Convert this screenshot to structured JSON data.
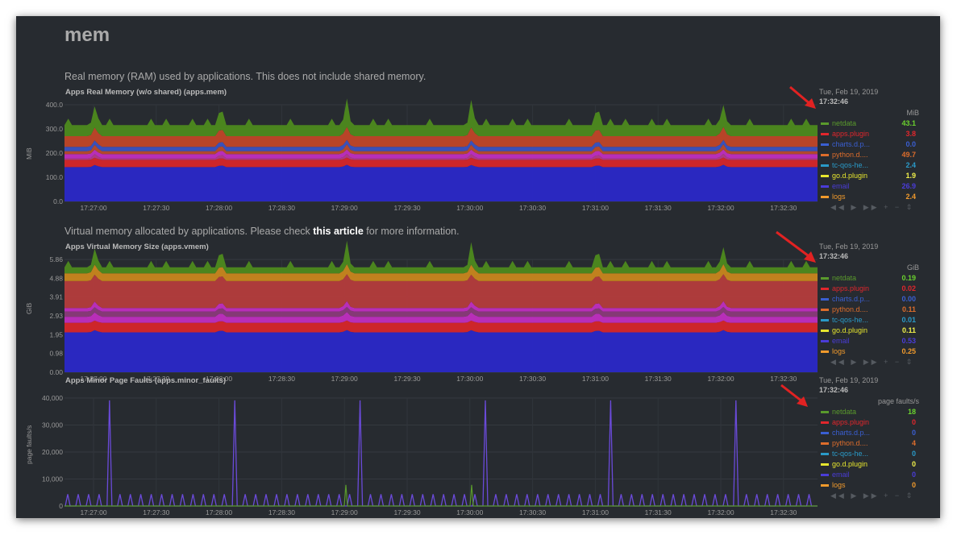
{
  "section": {
    "title": "mem"
  },
  "legend_series": [
    {
      "name": "netdata",
      "color": "#5a9a2c"
    },
    {
      "name": "apps.plugin",
      "color": "#e0262c"
    },
    {
      "name": "charts.d.p...",
      "color": "#3a5fd2"
    },
    {
      "name": "python.d....",
      "color": "#dd6d2b"
    },
    {
      "name": "tc-qos-he...",
      "color": "#2a9ac8"
    },
    {
      "name": "go.d.plugin",
      "color": "#e6e62e"
    },
    {
      "name": "email",
      "color": "#4a3cd8"
    },
    {
      "name": "logs",
      "color": "#f09a2c"
    }
  ],
  "controls": {
    "icons": [
      "rewind-icon",
      "play-icon",
      "forward-icon",
      "zoom-in-icon",
      "zoom-out-icon",
      "resize-icon"
    ],
    "glyphs": [
      "◀◀",
      "▶",
      "▶▶",
      "+",
      "−",
      "⇕"
    ]
  },
  "charts": [
    {
      "description": "Real memory (RAM) used by applications. This does not include shared memory.",
      "title": "Apps Real Memory (w/o shared) (apps.mem)",
      "y_unit_label": "MiB",
      "legend_units": "MiB",
      "date": "Tue, Feb 19, 2019",
      "time": "17:32:46",
      "values": [
        "43.1",
        "3.8",
        "0.0",
        "49.7",
        "2.4",
        "1.9",
        "26.9",
        "2.4"
      ],
      "value_colors": [
        "#6ad22e",
        "#e0262c",
        "#3a5fd2",
        "#dd6d2b",
        "#2a9ac8",
        "#f0f04a",
        "#4a3cd8",
        "#f09a2c"
      ]
    },
    {
      "description": "Virtual memory allocated by applications. Please check ",
      "link": "this article",
      "description_after": " for more information.",
      "title": "Apps Virtual Memory Size (apps.vmem)",
      "y_unit_label": "GiB",
      "legend_units": "GiB",
      "date": "Tue, Feb 19, 2019",
      "time": "17:32:46",
      "values": [
        "0.19",
        "0.02",
        "0.00",
        "0.11",
        "0.01",
        "0.11",
        "0.53",
        "0.25"
      ],
      "value_colors": [
        "#6ad22e",
        "#e0262c",
        "#3a5fd2",
        "#dd6d2b",
        "#2a9ac8",
        "#f0f04a",
        "#4a3cd8",
        "#f09a2c"
      ]
    },
    {
      "title": "Apps Minor Page Faults (apps.minor_faults)",
      "y_unit_label": "page faults/s",
      "legend_units": "page faults/s",
      "date": "Tue, Feb 19, 2019",
      "time": "17:32:46",
      "values": [
        "18",
        "0",
        "0",
        "4",
        "0",
        "0",
        "0",
        "0"
      ],
      "value_colors": [
        "#6ad22e",
        "#e0262c",
        "#3a5fd2",
        "#dd6d2b",
        "#2a9ac8",
        "#f0f04a",
        "#4a3cd8",
        "#f09a2c"
      ]
    }
  ],
  "chart_data": [
    {
      "type": "area",
      "title": "Apps Real Memory (w/o shared) (apps.mem)",
      "ylabel": "MiB",
      "ylim": [
        0,
        400
      ],
      "yticks": [
        "400.0",
        "300.0",
        "200.0",
        "100.0",
        "0.0"
      ],
      "x_ticks": [
        "17:27:00",
        "17:27:30",
        "17:28:00",
        "17:28:30",
        "17:29:00",
        "17:29:30",
        "17:30:00",
        "17:30:30",
        "17:31:00",
        "17:31:30",
        "17:32:00",
        "17:32:30"
      ],
      "stacked": true,
      "series": [
        {
          "name": "email",
          "color": "#2a28c8",
          "value": 142
        },
        {
          "name": "apps.plugin",
          "color": "#d6262a",
          "value": 30
        },
        {
          "name": "go.d.plugin",
          "color": "#b43a8a",
          "value": 6
        },
        {
          "name": "tc-qos-he...",
          "color": "#c02ec0",
          "value": 18
        },
        {
          "name": "python.d....",
          "color": "#b84a2c",
          "value": 12
        },
        {
          "name": "charts.d.p...",
          "color": "#3a52c2",
          "value": 18
        },
        {
          "name": "logs",
          "color": "#c04628",
          "value": 44
        },
        {
          "name": "netdata",
          "color": "#4d8a1e",
          "value": 46
        }
      ]
    },
    {
      "type": "area",
      "title": "Apps Virtual Memory Size (apps.vmem)",
      "ylabel": "GiB",
      "ylim": [
        0,
        6.5
      ],
      "yticks": [
        "5.86",
        "4.88",
        "3.91",
        "2.93",
        "1.95",
        "0.98",
        "0.00"
      ],
      "x_ticks": [
        "17:27:00",
        "17:27:30",
        "17:28:00",
        "17:28:30",
        "17:29:00",
        "17:29:30",
        "17:30:00",
        "17:30:30",
        "17:31:00",
        "17:31:30",
        "17:32:00",
        "17:32:30"
      ],
      "stacked": true,
      "series": [
        {
          "name": "email",
          "color": "#2a28c8",
          "value": 2.3
        },
        {
          "name": "apps.plugin",
          "color": "#d6262a",
          "value": 0.55
        },
        {
          "name": "go.d.plugin",
          "color": "#c02ec0",
          "value": 0.35
        },
        {
          "name": "tc-qos-he...",
          "color": "#8a3a7a",
          "value": 0.3
        },
        {
          "name": "python.d....",
          "color": "#c02ec0",
          "value": 0.2
        },
        {
          "name": "logs",
          "color": "#b43c3c",
          "value": 1.55
        },
        {
          "name": "charts.d.p...",
          "color": "#c8861e",
          "value": 0.45
        },
        {
          "name": "netdata",
          "color": "#4d8a1e",
          "value": 0.35
        }
      ]
    },
    {
      "type": "line",
      "title": "Apps Minor Page Faults (apps.minor_faults)",
      "ylabel": "page faults/s",
      "ylim": [
        0,
        46000
      ],
      "yticks": [
        "40,000",
        "30,000",
        "20,000",
        "10,000",
        "0"
      ],
      "x_ticks": [
        "17:27:00",
        "17:27:30",
        "17:28:00",
        "17:28:30",
        "17:29:00",
        "17:29:30",
        "17:30:00",
        "17:30:30",
        "17:31:00",
        "17:31:30",
        "17:32:00",
        "17:32:30"
      ],
      "baseline_spike": 5000,
      "big_spikes": [
        45000,
        45000,
        45000,
        45000,
        45000,
        45000
      ],
      "series": [
        {
          "name": "email",
          "color": "#6a4ad8"
        },
        {
          "name": "netdata",
          "color": "#5a9a2c"
        }
      ]
    }
  ]
}
